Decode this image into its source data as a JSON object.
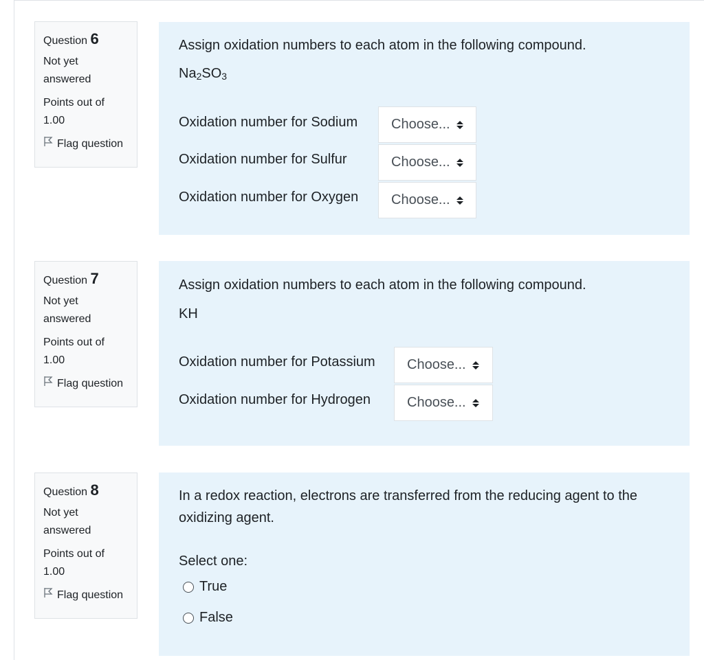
{
  "questions": [
    {
      "label": "Question",
      "number": "6",
      "state": "Not yet answered",
      "points": "Points out of 1.00",
      "flag": "Flag question",
      "text": "Assign oxidation numbers to each atom in the following compound.",
      "formula_parts": [
        "Na",
        "2",
        "SO",
        "3"
      ],
      "rows": [
        {
          "label": "Oxidation number for Sodium",
          "select": "Choose..."
        },
        {
          "label": "Oxidation number for Sulfur",
          "select": "Choose..."
        },
        {
          "label": "Oxidation number for Oxygen",
          "select": "Choose..."
        }
      ]
    },
    {
      "label": "Question",
      "number": "7",
      "state": "Not yet answered",
      "points": "Points out of 1.00",
      "flag": "Flag question",
      "text": "Assign oxidation numbers to each atom in the following compound.",
      "formula": "KH",
      "rows": [
        {
          "label": "Oxidation number for Potassium",
          "select": "Choose..."
        },
        {
          "label": "Oxidation number for Hydrogen",
          "select": "Choose..."
        }
      ]
    },
    {
      "label": "Question",
      "number": "8",
      "state": "Not yet answered",
      "points": "Points out of 1.00",
      "flag": "Flag question",
      "text": "In a redox reaction, electrons are transferred from the reducing agent to the oxidizing agent.",
      "prompt": "Select one:",
      "options": [
        "True",
        "False"
      ]
    }
  ]
}
